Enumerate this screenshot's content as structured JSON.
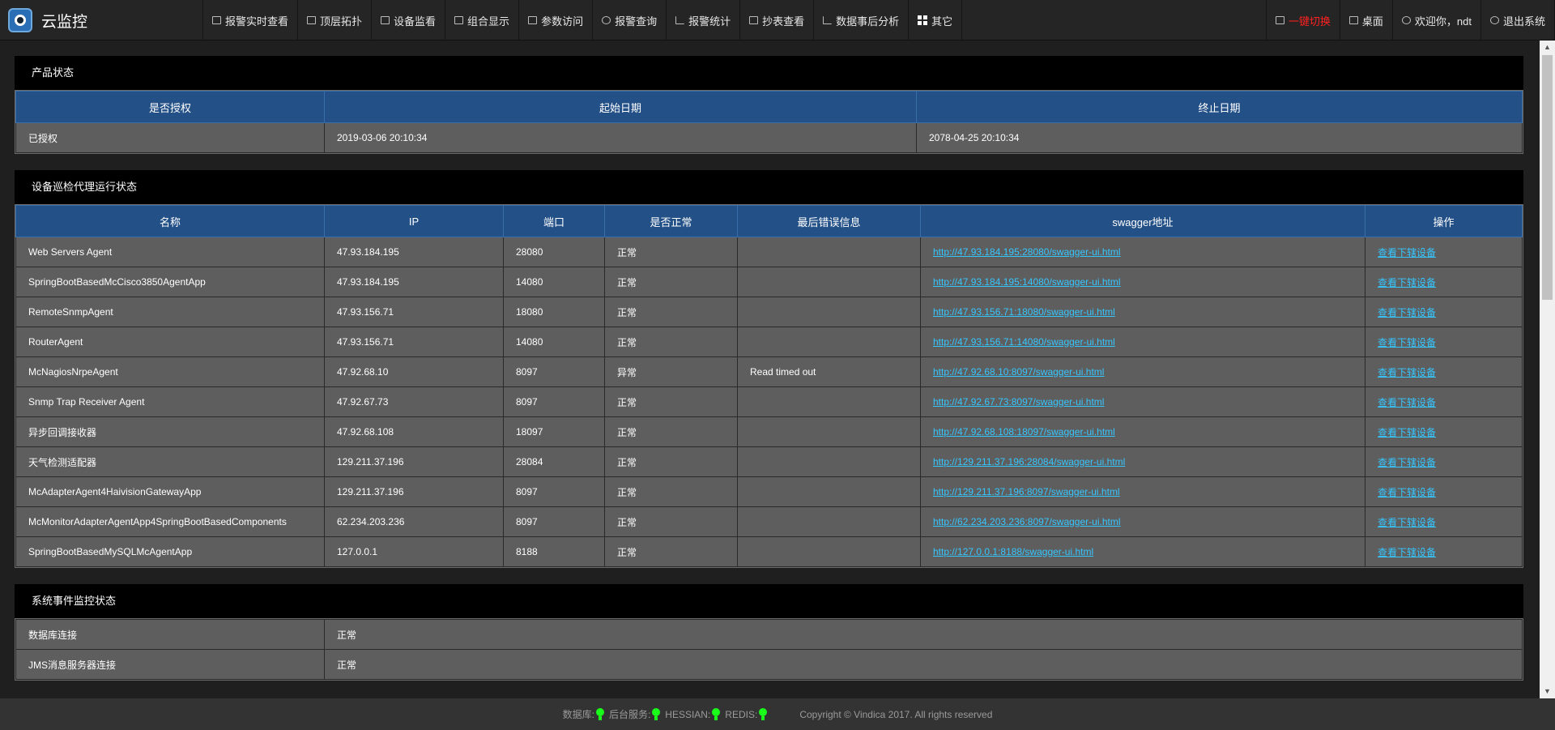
{
  "app": {
    "title": "云监控"
  },
  "nav": {
    "items": [
      {
        "label": "报警实时查看",
        "icon": "monitor-icon"
      },
      {
        "label": "顶层拓扑",
        "icon": "grid-icon"
      },
      {
        "label": "设备监看",
        "icon": "grid-icon"
      },
      {
        "label": "组合显示",
        "icon": "grid-icon"
      },
      {
        "label": "参数访问",
        "icon": "list-icon"
      },
      {
        "label": "报警查询",
        "icon": "speaker-icon"
      },
      {
        "label": "报警统计",
        "icon": "chart-icon"
      },
      {
        "label": "抄表查看",
        "icon": "table-icon"
      },
      {
        "label": "数据事后分析",
        "icon": "chart-icon"
      },
      {
        "label": "其它",
        "icon": "apps-icon"
      }
    ],
    "right": {
      "switch_label": "一键切换",
      "desktop_label": "桌面",
      "welcome_label": "欢迎你，ndt",
      "logout_label": "退出系统"
    }
  },
  "product_status": {
    "title": "产品状态",
    "headers": [
      "是否授权",
      "起始日期",
      "终止日期"
    ],
    "row": [
      "已授权",
      "2019-03-06 20:10:34",
      "2078-04-25 20:10:34"
    ]
  },
  "agents": {
    "title": "设备巡检代理运行状态",
    "headers": [
      "名称",
      "IP",
      "端口",
      "是否正常",
      "最后错误信息",
      "swagger地址",
      "操作"
    ],
    "rows": [
      {
        "name": "Web Servers Agent",
        "ip": "47.93.184.195",
        "port": "28080",
        "status": "正常",
        "error": "",
        "swagger": "http://47.93.184.195:28080/swagger-ui.html",
        "action": "查看下辖设备"
      },
      {
        "name": "SpringBootBasedMcCisco3850AgentApp",
        "ip": "47.93.184.195",
        "port": "14080",
        "status": "正常",
        "error": "",
        "swagger": "http://47.93.184.195:14080/swagger-ui.html",
        "action": "查看下辖设备"
      },
      {
        "name": "RemoteSnmpAgent",
        "ip": "47.93.156.71",
        "port": "18080",
        "status": "正常",
        "error": "",
        "swagger": "http://47.93.156.71:18080/swagger-ui.html",
        "action": "查看下辖设备"
      },
      {
        "name": "RouterAgent",
        "ip": "47.93.156.71",
        "port": "14080",
        "status": "正常",
        "error": "",
        "swagger": "http://47.93.156.71:14080/swagger-ui.html",
        "action": "查看下辖设备"
      },
      {
        "name": "McNagiosNrpeAgent",
        "ip": "47.92.68.10",
        "port": "8097",
        "status": "异常",
        "error": "Read timed out",
        "swagger": "http://47.92.68.10:8097/swagger-ui.html",
        "action": "查看下辖设备"
      },
      {
        "name": "Snmp Trap Receiver Agent",
        "ip": "47.92.67.73",
        "port": "8097",
        "status": "正常",
        "error": "",
        "swagger": "http://47.92.67.73:8097/swagger-ui.html",
        "action": "查看下辖设备"
      },
      {
        "name": "异步回调接收器",
        "ip": "47.92.68.108",
        "port": "18097",
        "status": "正常",
        "error": "",
        "swagger": "http://47.92.68.108:18097/swagger-ui.html",
        "action": "查看下辖设备"
      },
      {
        "name": "天气检测适配器",
        "ip": "129.211.37.196",
        "port": "28084",
        "status": "正常",
        "error": "",
        "swagger": "http://129.211.37.196:28084/swagger-ui.html",
        "action": "查看下辖设备"
      },
      {
        "name": "McAdapterAgent4HaivisionGatewayApp",
        "ip": "129.211.37.196",
        "port": "8097",
        "status": "正常",
        "error": "",
        "swagger": "http://129.211.37.196:8097/swagger-ui.html",
        "action": "查看下辖设备"
      },
      {
        "name": "McMonitorAdapterAgentApp4SpringBootBasedComponents",
        "ip": "62.234.203.236",
        "port": "8097",
        "status": "正常",
        "error": "",
        "swagger": "http://62.234.203.236:8097/swagger-ui.html",
        "action": "查看下辖设备"
      },
      {
        "name": "SpringBootBasedMySQLMcAgentApp",
        "ip": "127.0.0.1",
        "port": "8188",
        "status": "正常",
        "error": "",
        "swagger": "http://127.0.0.1:8188/swagger-ui.html",
        "action": "查看下辖设备"
      }
    ]
  },
  "system_events": {
    "title": "系统事件监控状态",
    "rows": [
      {
        "name": "数据库连接",
        "status": "正常"
      },
      {
        "name": "JMS消息服务器连接",
        "status": "正常"
      }
    ]
  },
  "footer": {
    "indicators": [
      "数据库:",
      "后台服务:",
      "HESSIAN:",
      "REDIS:"
    ],
    "copyright": "Copyright © Vindica 2017. All rights reserved"
  },
  "colors": {
    "header_blue": "#235087",
    "row_gray": "#5e5e5e",
    "link": "#35c6ff",
    "danger": "#ff2020",
    "ok_green": "#1aff1a"
  }
}
